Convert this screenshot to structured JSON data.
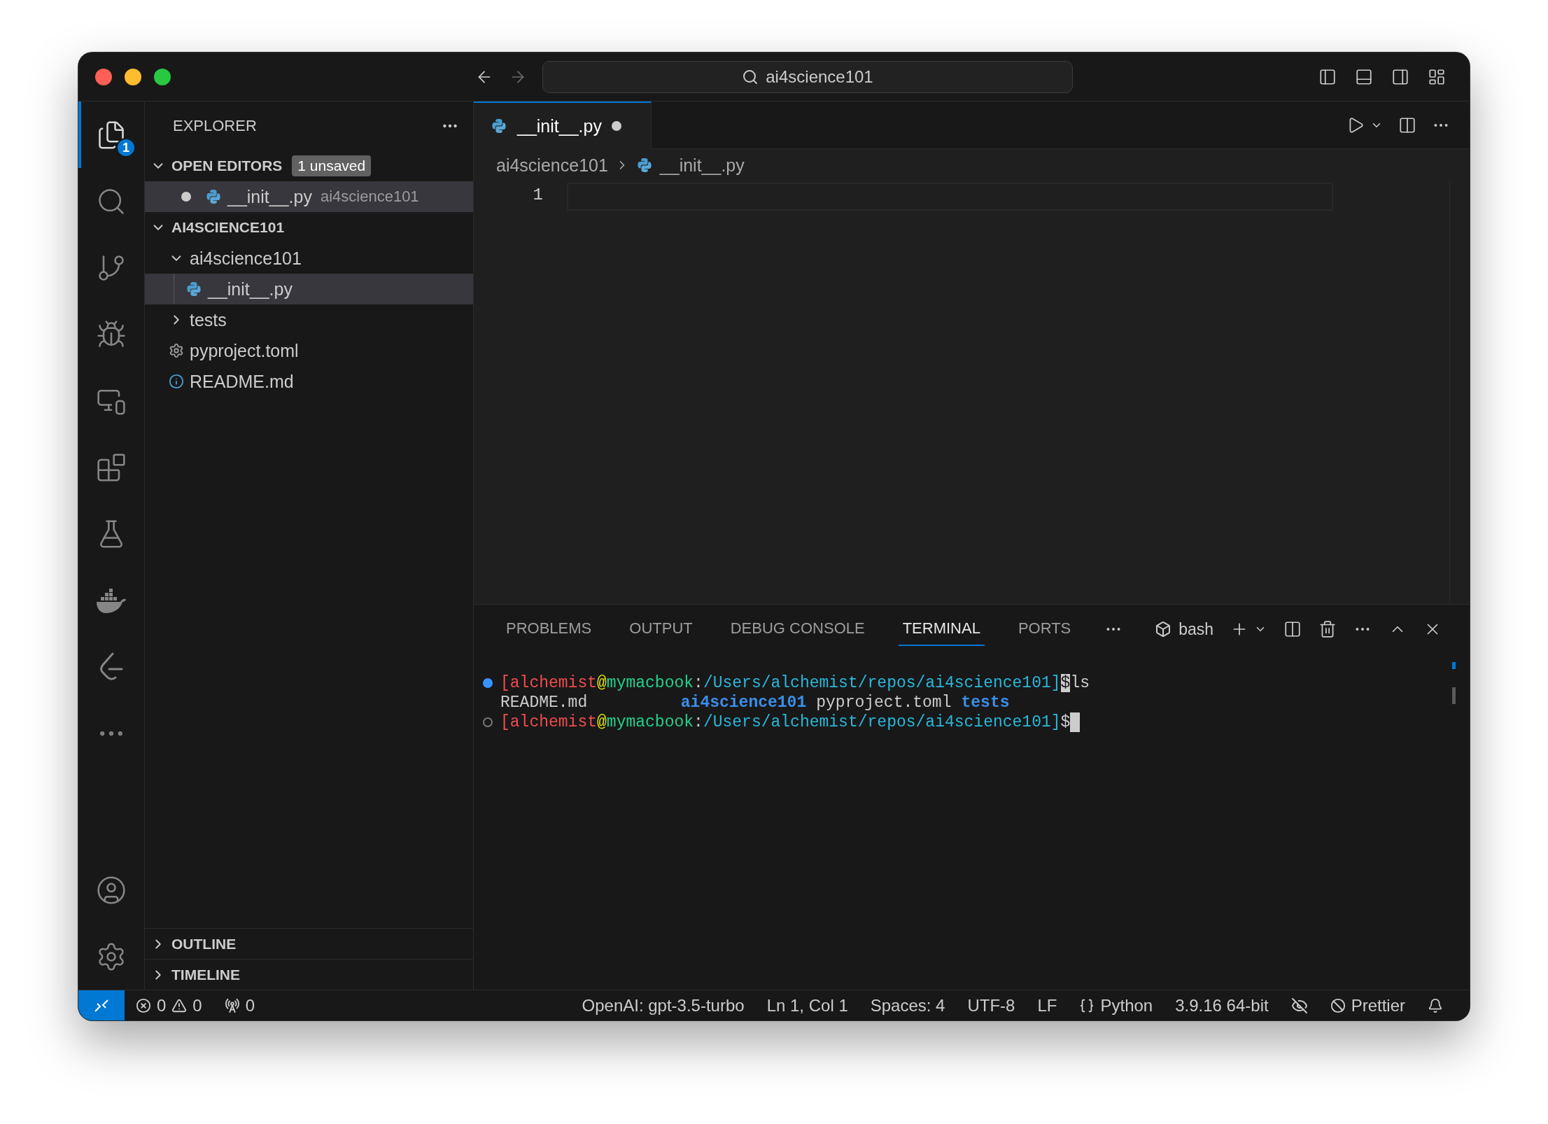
{
  "title_bar": {
    "search": "ai4science101"
  },
  "activity_bar": {
    "items": [
      {
        "kind": "explorer",
        "selected": true,
        "badge": "1"
      },
      {
        "kind": "search",
        "selected": false
      },
      {
        "kind": "source_control",
        "selected": false
      },
      {
        "kind": "run_debug",
        "selected": false
      },
      {
        "kind": "remote",
        "selected": false
      },
      {
        "kind": "extensions",
        "selected": false
      },
      {
        "kind": "testing",
        "selected": false
      },
      {
        "kind": "docker",
        "selected": false
      },
      {
        "kind": "leetcode",
        "selected": false
      },
      {
        "kind": "more",
        "selected": false
      }
    ],
    "bottom_items": [
      {
        "kind": "accounts"
      },
      {
        "kind": "manage"
      }
    ]
  },
  "sidebar": {
    "title": "EXPLORER",
    "open_editors": {
      "title": "OPEN EDITORS",
      "expanded": true,
      "badge": "1 unsaved",
      "items": [
        {
          "name": "__init__.py",
          "path": "ai4science101",
          "kind": "python",
          "unsaved": true,
          "selected": true
        }
      ]
    },
    "folder": {
      "title": "AI4SCIENCE101",
      "expanded": true,
      "children": [
        {
          "name": "ai4science101",
          "kind": "folder",
          "expanded": true,
          "selected": false,
          "children": [
            {
              "name": "__init__.py",
              "kind": "python",
              "selected": true
            }
          ]
        },
        {
          "name": "tests",
          "kind": "folder",
          "expanded": false,
          "selected": false
        },
        {
          "name": "pyproject.toml",
          "kind": "config",
          "selected": false
        },
        {
          "name": "README.md",
          "kind": "info",
          "selected": false
        }
      ]
    },
    "collapsed_sections": [
      {
        "title": "OUTLINE",
        "expanded": false
      },
      {
        "title": "TIMELINE",
        "expanded": false
      }
    ]
  },
  "editor": {
    "tabs": [
      {
        "label": "__init__.py",
        "kind": "python",
        "unsaved": true,
        "selected": true
      }
    ],
    "breadcrumb": [
      {
        "label": "ai4science101",
        "kind": "folder"
      },
      {
        "label": "__init__.py",
        "kind": "python"
      }
    ],
    "line_numbers": [
      "1"
    ]
  },
  "panel": {
    "tabs": [
      {
        "label": "PROBLEMS",
        "selected": false
      },
      {
        "label": "OUTPUT",
        "selected": false
      },
      {
        "label": "DEBUG CONSOLE",
        "selected": false
      },
      {
        "label": "TERMINAL",
        "selected": true
      },
      {
        "label": "PORTS",
        "selected": false
      }
    ],
    "terminal_profile": "bash",
    "terminal_lines": [
      {
        "dot_filled": true,
        "cursor": false,
        "segments": [
          {
            "text": "[alchemist",
            "kind": "user"
          },
          {
            "text": "@",
            "kind": "at"
          },
          {
            "text": "mymacbook",
            "kind": "host"
          },
          {
            "text": ":",
            "kind": "plain"
          },
          {
            "text": "/Users/alchemist/repos/ai4science101]",
            "kind": "path"
          },
          {
            "text": "$",
            "kind": "inverse"
          },
          {
            "text": "ls",
            "kind": "plain"
          }
        ]
      },
      {
        "cursor": false,
        "segments": [
          {
            "text": "README.md",
            "kind": "file"
          },
          {
            "text": "ai4science101",
            "kind": "dir"
          },
          {
            "text": "pyproject.toml",
            "kind": "file"
          },
          {
            "text": "tests",
            "kind": "dir"
          }
        ]
      },
      {
        "dot_filled": false,
        "cursor": true,
        "segments": [
          {
            "text": "[alchemist",
            "kind": "user"
          },
          {
            "text": "@",
            "kind": "at"
          },
          {
            "text": "mymacbook",
            "kind": "host"
          },
          {
            "text": ":",
            "kind": "plain"
          },
          {
            "text": "/Users/alchemist/repos/ai4science101]",
            "kind": "path"
          },
          {
            "text": "$",
            "kind": "plain"
          }
        ]
      }
    ]
  },
  "status_bar": {
    "errors": "0",
    "warnings": "0",
    "ports": "0",
    "items": [
      {
        "kind": "text",
        "label": "OpenAI: gpt-3.5-turbo"
      },
      {
        "kind": "text",
        "label": "Ln 1, Col 1"
      },
      {
        "kind": "text",
        "label": "Spaces: 4"
      },
      {
        "kind": "text",
        "label": "UTF-8"
      },
      {
        "kind": "text",
        "label": "LF"
      },
      {
        "kind": "language",
        "label": "Python"
      },
      {
        "kind": "text",
        "label": "3.9.16 64-bit"
      },
      {
        "kind": "copilot"
      },
      {
        "kind": "formatter",
        "label": "Prettier"
      },
      {
        "kind": "bell"
      }
    ]
  }
}
